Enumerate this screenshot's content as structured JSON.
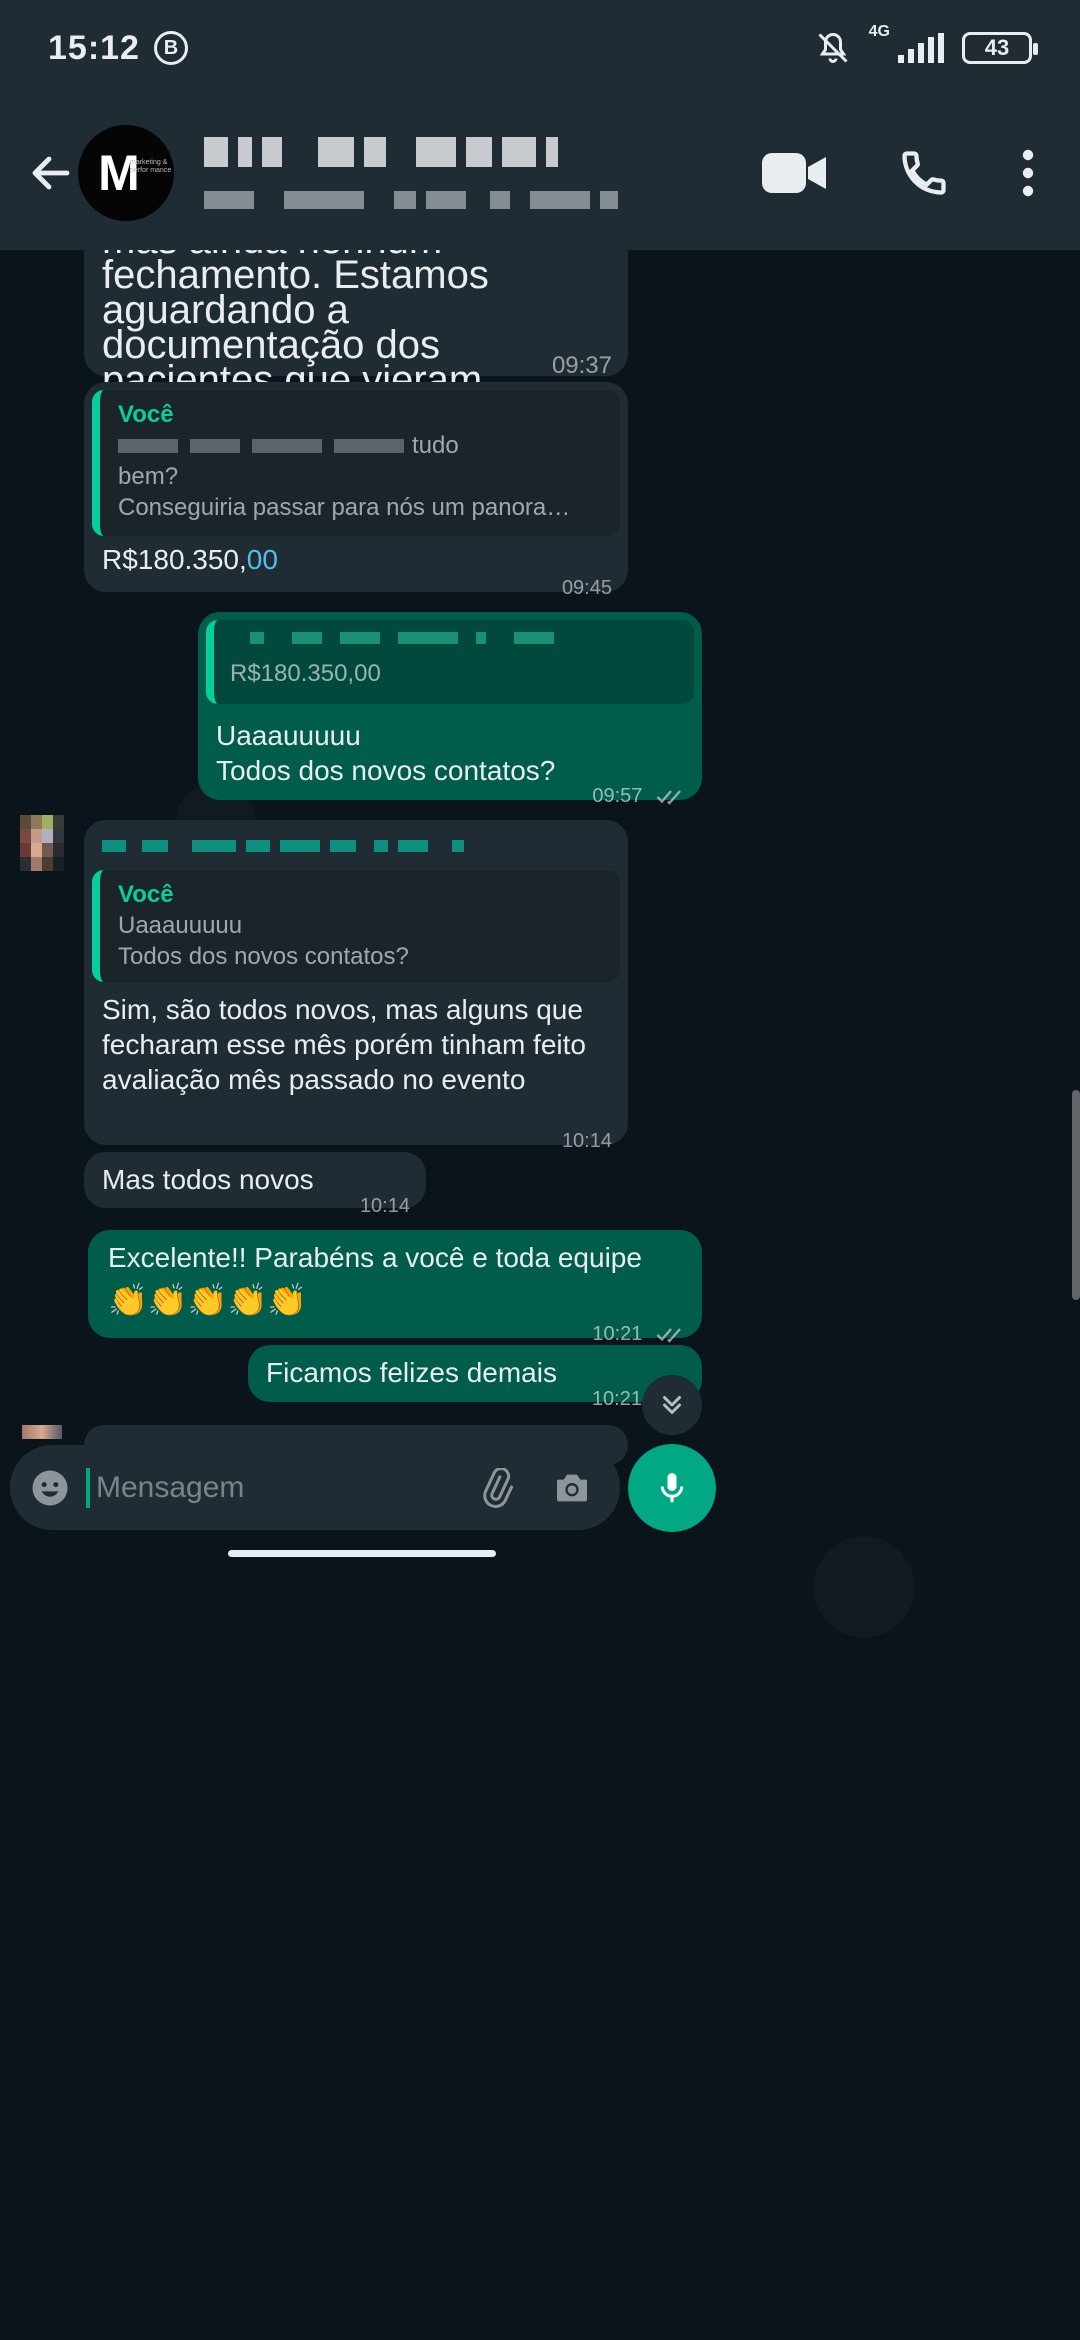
{
  "status_bar": {
    "time": "15:12",
    "badge": "B",
    "network": "4G",
    "battery": "43"
  },
  "header": {
    "avatar_letter": "M",
    "avatar_tagline": "marketing & perfor mance"
  },
  "messages": {
    "m1": {
      "text": "Então, tivemos avaliações, mas ainda nenhum fechamento. Estamos aguardando a documentação dos pacientes que vieram. Acredito que iremos conseguir fechar",
      "time": "09:37"
    },
    "m2": {
      "quote_author": "Você",
      "quote_line1_tail": "tudo",
      "quote_line2": "bem?",
      "quote_line3": "Conseguiria passar para nós um panora…",
      "amount_main": "R$180.350,",
      "amount_cents": "00",
      "time": "09:45"
    },
    "m3": {
      "quote_text": "R$180.350,00",
      "line1": "Uaaauuuuu",
      "line2": "Todos dos novos contatos?",
      "time": "09:57"
    },
    "m4": {
      "quote_author": "Você",
      "quote_line1": "Uaaauuuuu",
      "quote_line2": "Todos dos novos contatos?",
      "text": "Sim, são todos novos, mas alguns que fecharam esse mês porém tinham feito avaliação mês passado no evento",
      "time": "10:14"
    },
    "m5": {
      "text": "Mas todos novos",
      "time": "10:14"
    },
    "m6": {
      "text": "Excelente!! Parabéns a você e toda equipe",
      "emoji": "👏👏👏👏👏",
      "time": "10:21"
    },
    "m7": {
      "text": "Ficamos felizes demais",
      "time": "10:21"
    }
  },
  "input": {
    "placeholder": "Mensagem"
  },
  "colors": {
    "incoming": "#202c33",
    "outgoing": "#005c4b",
    "accent": "#00a884",
    "quote_accent": "#06cf9c",
    "link_blue": "#53bdeb"
  },
  "icons": [
    "back-arrow-icon",
    "video-call-icon",
    "voice-call-icon",
    "more-options-icon",
    "emoji-icon",
    "attach-icon",
    "camera-icon",
    "mic-icon",
    "scroll-down-icon",
    "double-check-icon"
  ]
}
